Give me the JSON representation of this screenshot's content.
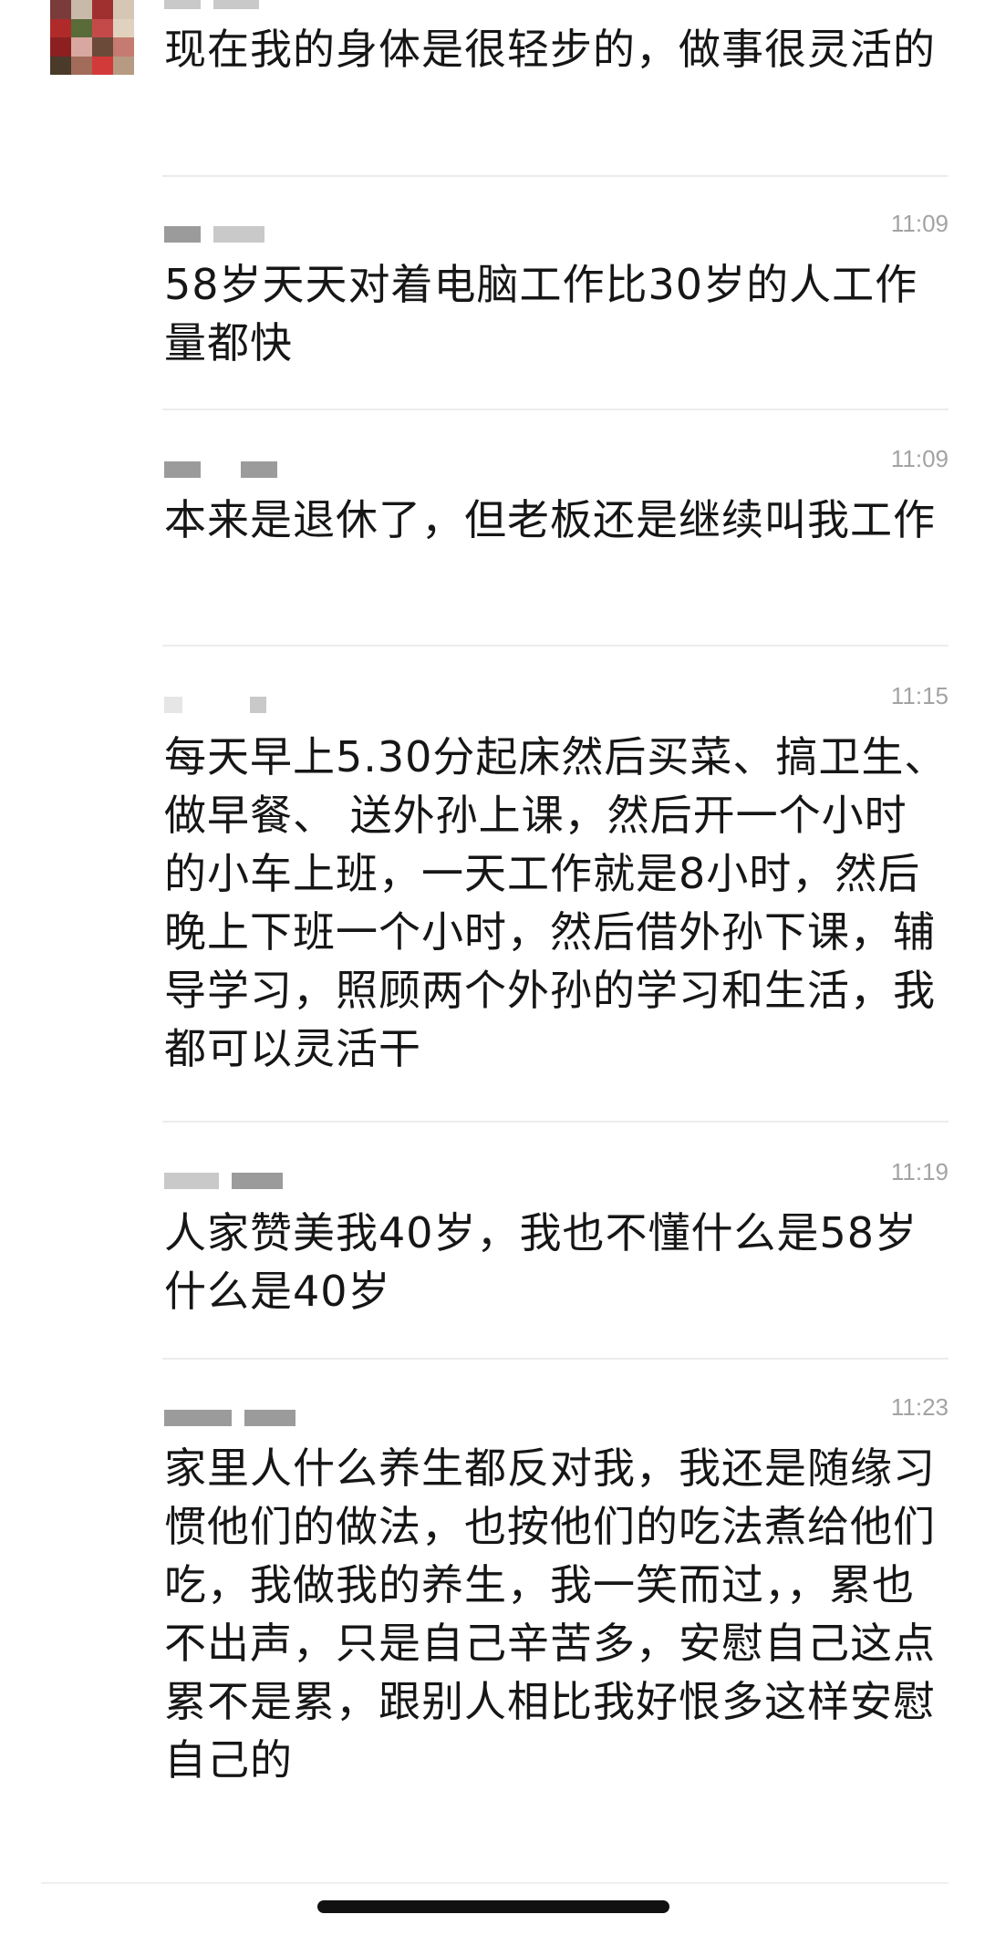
{
  "messages": [
    {
      "time": "",
      "text": "现在我的身体是很轻步的，做事很灵活的"
    },
    {
      "time": "11:09",
      "text": "58岁天天对着电脑工作比30岁的人工作量都快"
    },
    {
      "time": "11:09",
      "text": "本来是退休了，但老板还是继续叫我工作"
    },
    {
      "time": "11:15",
      "text": "每天早上5.30分起床然后买菜、搞卫生、做早餐、 送外孙上课，然后开一个小时的小车上班，一天工作就是8小时，然后晚上下班一个小时，然后借外孙下课，辅导学习，照顾两个外孙的学习和生活，我都可以灵活干"
    },
    {
      "time": "11:19",
      "text": "人家赞美我40岁，我也不懂什么是58岁什么是40岁"
    },
    {
      "time": "11:23",
      "text": "家里人什么养生都反对我，我还是随缘习惯他们的做法，也按他们的吃法煮给他们吃，我做我的养生，我一笑而过，，累也不出声，只是自己辛苦多，安慰自己这点累不是累，跟别人相比我好恨多这样安慰自己的"
    }
  ]
}
